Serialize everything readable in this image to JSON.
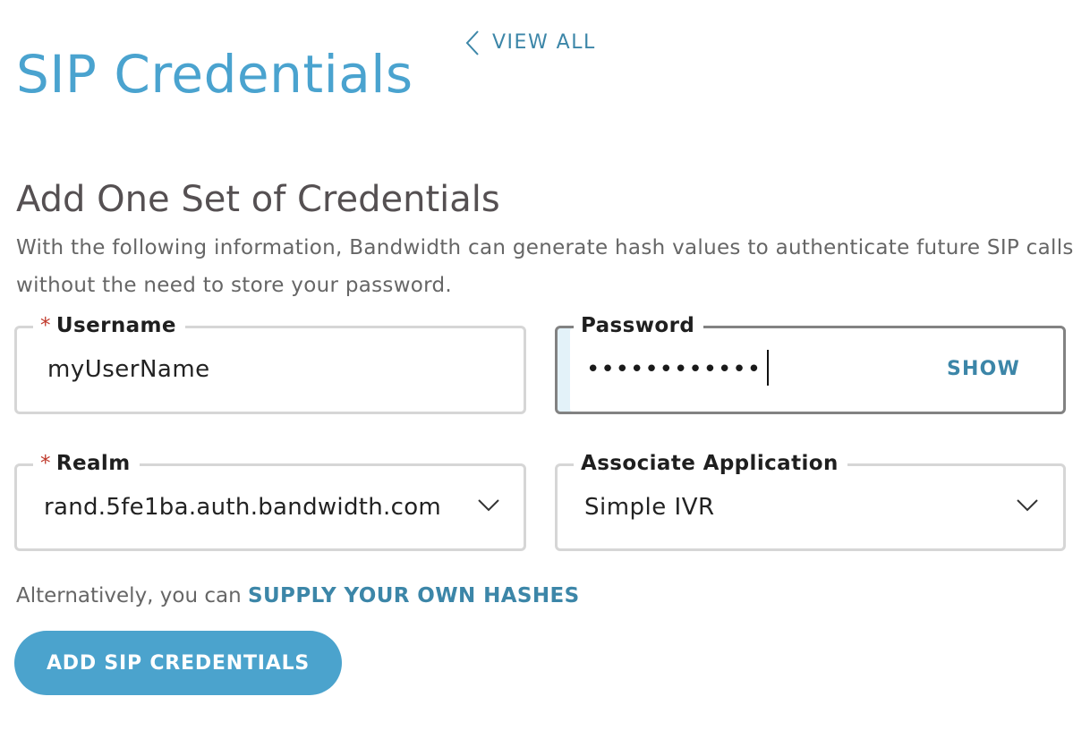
{
  "header": {
    "title": "SIP Credentials",
    "view_all_label": "VIEW ALL",
    "accent_color": "#4aa3cf"
  },
  "form": {
    "title": "Add One Set of Credentials",
    "description": "With the following information, Bandwidth can generate hash values to authenticate future SIP calls without the need to store your password.",
    "required_marker": "*",
    "username": {
      "label": "Username",
      "value": "myUserName",
      "required": true
    },
    "password": {
      "label": "Password",
      "value": "••••••••••••",
      "show_label": "SHOW",
      "focused": true
    },
    "realm": {
      "label": "Realm",
      "value": "rand.5fe1ba.auth.bandwidth.com",
      "required": true,
      "icon": "chevron-down-icon"
    },
    "application": {
      "label": "Associate Application",
      "value": "Simple IVR",
      "icon": "chevron-down-icon"
    },
    "alternative_text": "Alternatively, you can",
    "alternative_link": "SUPPLY YOUR OWN HASHES",
    "submit_label": "ADD SIP CREDENTIALS",
    "button_color": "#4ba3cd",
    "link_color": "#3c86a8"
  }
}
